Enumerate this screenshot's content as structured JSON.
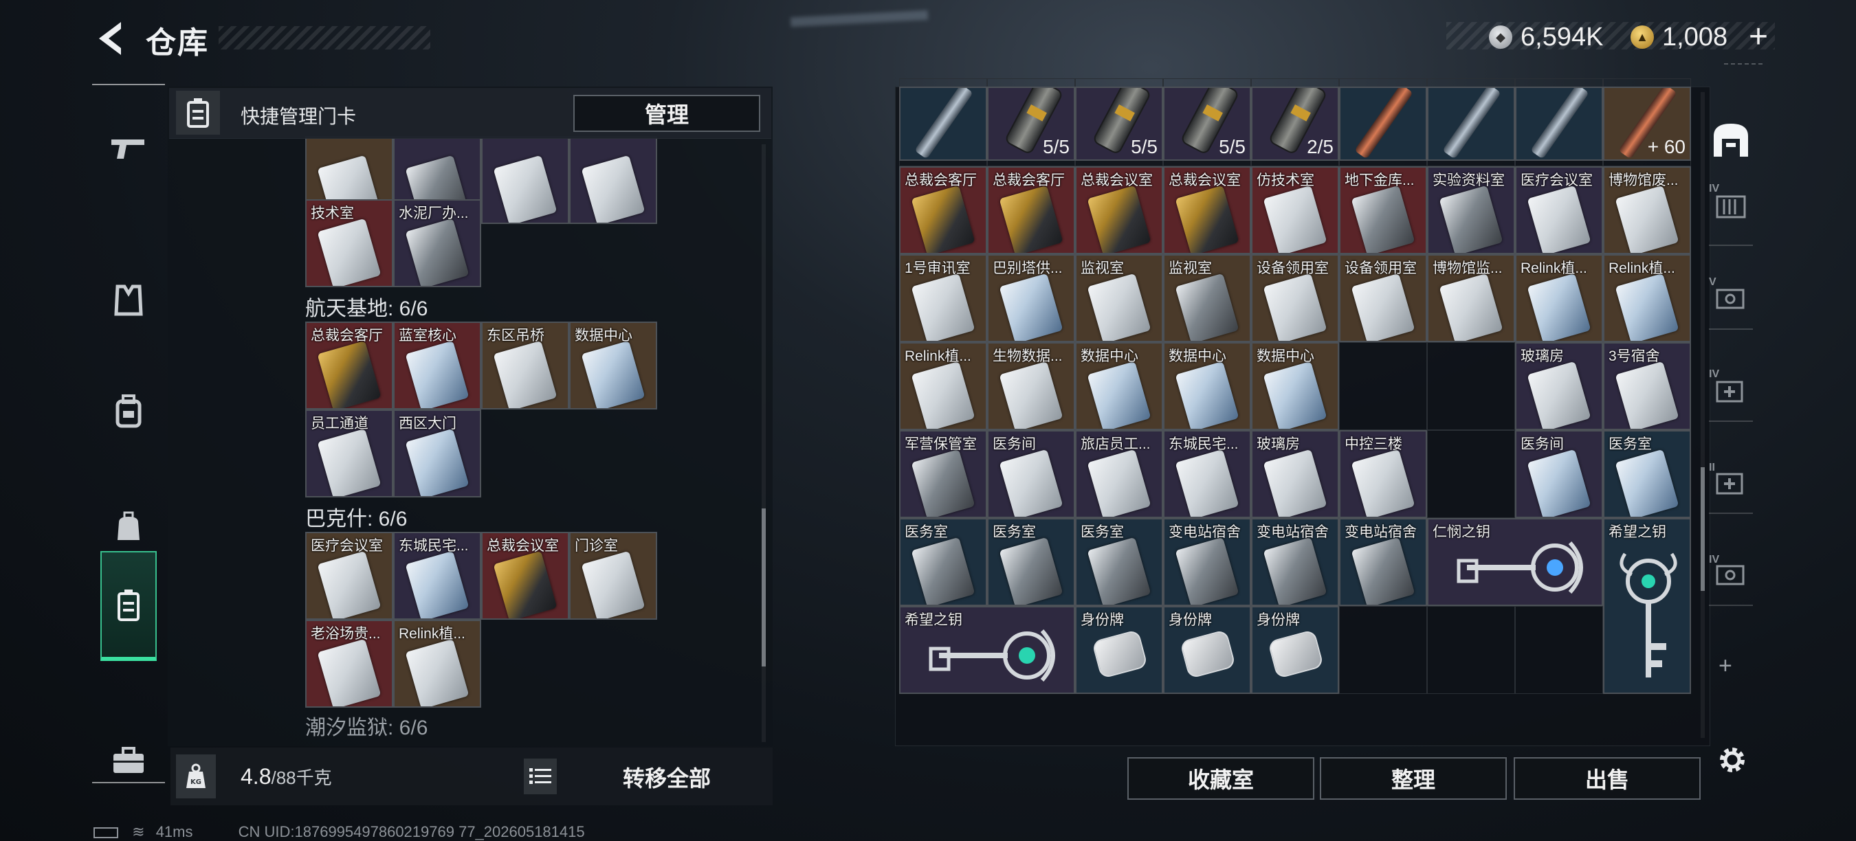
{
  "header": {
    "title": "仓库",
    "currency_silver": "6,594K",
    "currency_gold": "1,008",
    "add_label": "+"
  },
  "left_panel": {
    "header_title": "快捷管理门卡",
    "manage_label": "管理",
    "groups": [
      {
        "label": "航天基地: 6/6"
      },
      {
        "label": "巴克什: 6/6"
      },
      {
        "label": "潮汐监狱: 6/6"
      }
    ],
    "top_cards": [
      {
        "name": "技术室"
      },
      {
        "name": "水泥厂办..."
      }
    ],
    "group1_cards": [
      {
        "name": "总裁会客厅"
      },
      {
        "name": "蓝室核心"
      },
      {
        "name": "东区吊桥"
      },
      {
        "name": "数据中心"
      },
      {
        "name": "员工通道"
      },
      {
        "name": "西区大门"
      }
    ],
    "group2_cards": [
      {
        "name": "医疗会议室"
      },
      {
        "name": "东城民宅..."
      },
      {
        "name": "总裁会议室"
      },
      {
        "name": "门诊室"
      },
      {
        "name": "老浴场贵..."
      },
      {
        "name": "Relink植..."
      }
    ],
    "weight_value": "4.8",
    "weight_max": "/88千克",
    "transfer_label": "转移全部"
  },
  "storage": {
    "row0_qty": [
      "5/5",
      "5/5",
      "5/5",
      "2/5",
      "+ 60"
    ],
    "rows": [
      [
        "总裁会客厅",
        "总裁会客厅",
        "总裁会议室",
        "总裁会议室",
        "仿技术室",
        "地下金库...",
        "实验资料室",
        "医疗会议室",
        "博物馆废..."
      ],
      [
        "1号审讯室",
        "巴别塔供...",
        "监视室",
        "监视室",
        "设备领用室",
        "设备领用室",
        "博物馆监...",
        "Relink植...",
        "Relink植..."
      ],
      [
        "Relink植...",
        "生物数据...",
        "数据中心",
        "数据中心",
        "数据中心",
        "",
        "",
        "玻璃房",
        "3号宿舍"
      ],
      [
        "军营保管室",
        "医务间",
        "旅店员工...",
        "东城民宅...",
        "玻璃房",
        "中控三楼",
        "",
        "医务间",
        "医务室"
      ],
      [
        "医务室",
        "医务室",
        "医务室",
        "变电站宿舍",
        "变电站宿舍",
        "变电站宿舍",
        "仁悯之钥",
        "",
        "希望之钥"
      ],
      [
        "希望之钥",
        "",
        "身份牌",
        "身份牌",
        "身份牌"
      ]
    ],
    "buttons": {
      "collection": "收藏室",
      "sort": "整理",
      "sell": "出售"
    }
  },
  "side_tabs": [
    {
      "lv": "IV"
    },
    {
      "lv": "V"
    },
    {
      "lv": "IV"
    },
    {
      "lv": "II"
    },
    {
      "lv": "IV"
    }
  ],
  "status_bar": {
    "ping": "41ms",
    "uid": "CN UID:1876995497860219769 77_202605181415"
  },
  "colors": {
    "accent": "#3be0a0",
    "bg_brown": "#4a3a2a",
    "bg_red": "#5a2428",
    "bg_purple": "#2e2940",
    "bg_blue": "#1c2f3e"
  }
}
